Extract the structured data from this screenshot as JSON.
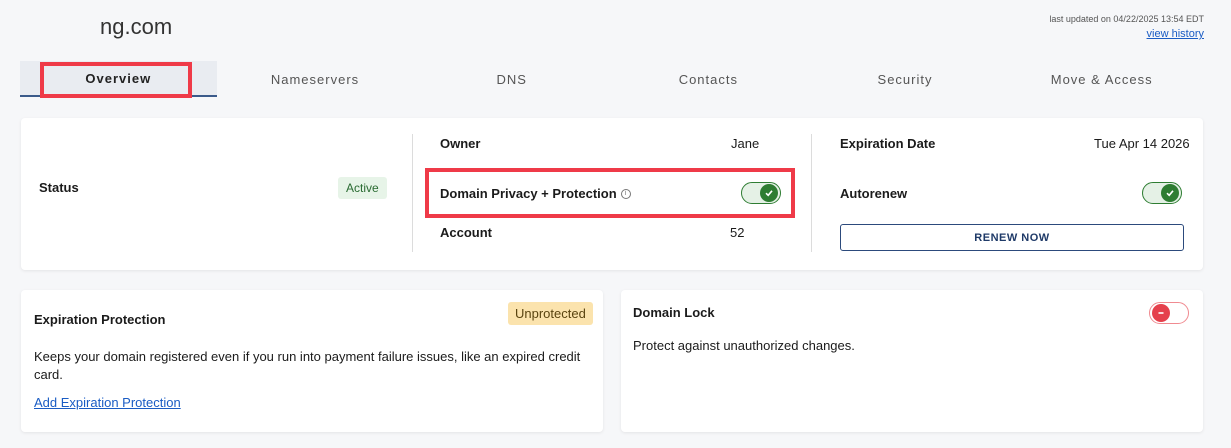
{
  "header": {
    "domain": "ng.com",
    "last_updated": "last updated on 04/22/2025 13:54 EDT",
    "history_link": "view history"
  },
  "tabs": [
    {
      "label": "Overview",
      "active": true
    },
    {
      "label": "Nameservers"
    },
    {
      "label": "DNS"
    },
    {
      "label": "Contacts"
    },
    {
      "label": "Security"
    },
    {
      "label": "Move & Access"
    }
  ],
  "summary": {
    "status_label": "Status",
    "status_value": "Active",
    "owner_label": "Owner",
    "owner_value": "Jane",
    "privacy_label": "Domain Privacy + Protection",
    "privacy_enabled": true,
    "account_label": "Account",
    "account_value": "52",
    "expiration_label": "Expiration Date",
    "expiration_value": "Tue Apr 14 2026",
    "autorenew_label": "Autorenew",
    "autorenew_enabled": true,
    "renew_button": "RENEW NOW"
  },
  "expiration_protection": {
    "title": "Expiration Protection",
    "badge": "Unprotected",
    "description": "Keeps your domain registered even if you run into payment failure issues, like an expired credit card.",
    "link": "Add Expiration Protection"
  },
  "domain_lock": {
    "title": "Domain Lock",
    "description": "Protect against unauthorized changes.",
    "enabled": false
  },
  "colors": {
    "accent": "#1f3a68",
    "success": "#2e7d32",
    "danger": "#e5404c",
    "highlight": "#ef3a48"
  }
}
